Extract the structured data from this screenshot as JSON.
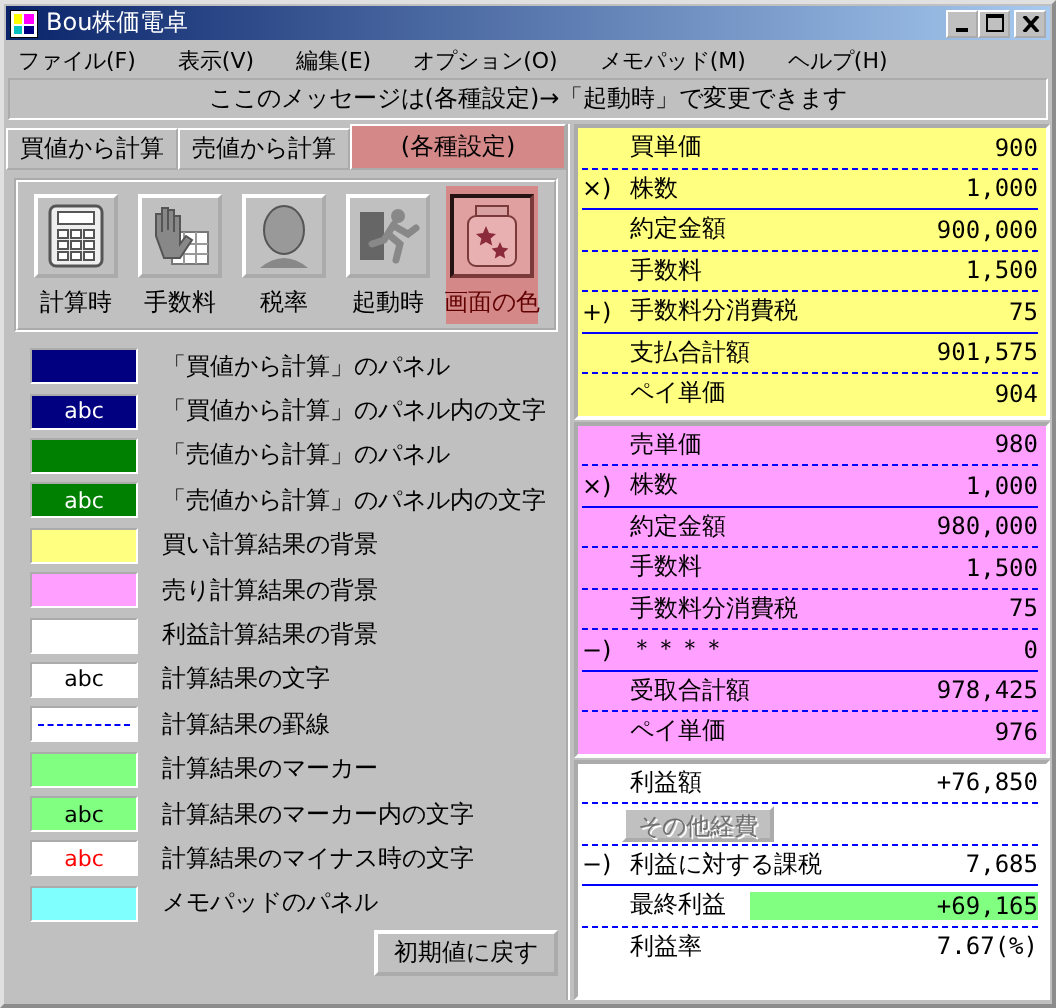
{
  "window": {
    "title": "Bou株価電卓"
  },
  "menu": [
    "ファイル(F)",
    "表示(V)",
    "編集(E)",
    "オプション(O)",
    "メモパッド(M)",
    "ヘルプ(H)"
  ],
  "message": "ここのメッセージは(各種設定)→「起動時」で変更できます",
  "tabs": [
    {
      "label": "買値から計算",
      "selected": false
    },
    {
      "label": "売値から計算",
      "selected": false
    },
    {
      "label": "(各種設定)",
      "selected": true
    }
  ],
  "settings_tools": [
    {
      "label": "計算時",
      "selected": false
    },
    {
      "label": "手数料",
      "selected": false
    },
    {
      "label": "税率",
      "selected": false
    },
    {
      "label": "起動時",
      "selected": false
    },
    {
      "label": "画面の色",
      "selected": true
    }
  ],
  "color_settings": [
    {
      "kind": "fill",
      "color": "#000080",
      "label": "「買値から計算」のパネル"
    },
    {
      "kind": "text",
      "color": "#000080",
      "sample": {
        "text": "abc",
        "color": "#ffffff"
      },
      "label": "「買値から計算」のパネル内の文字"
    },
    {
      "kind": "fill",
      "color": "#008000",
      "label": "「売値から計算」のパネル"
    },
    {
      "kind": "text",
      "color": "#008000",
      "sample": {
        "text": "abc",
        "color": "#ffffff"
      },
      "label": "「売値から計算」のパネル内の文字"
    },
    {
      "kind": "fill",
      "color": "#ffff80",
      "label": "買い計算結果の背景"
    },
    {
      "kind": "fill",
      "color": "#ff9fff",
      "label": "売り計算結果の背景"
    },
    {
      "kind": "fill",
      "color": "#ffffff",
      "label": "利益計算結果の背景"
    },
    {
      "kind": "text",
      "color": "#ffffff",
      "sample": {
        "text": "abc",
        "color": "#000000"
      },
      "label": "計算結果の文字"
    },
    {
      "kind": "line",
      "color": "#0000ff",
      "label": "計算結果の罫線"
    },
    {
      "kind": "fill",
      "color": "#80ff80",
      "label": "計算結果のマーカー"
    },
    {
      "kind": "text",
      "color": "#80ff80",
      "sample": {
        "text": "abc",
        "color": "#000000"
      },
      "label": "計算結果のマーカー内の文字"
    },
    {
      "kind": "text",
      "color": "#ffffff",
      "sample": {
        "text": "abc",
        "color": "#ff0000"
      },
      "label": "計算結果のマイナス時の文字"
    },
    {
      "kind": "fill",
      "color": "#80ffff",
      "label": "メモパッドのパネル"
    }
  ],
  "reset_button": "初期値に戻す",
  "buy_result": [
    {
      "label": "買単価",
      "value": "900",
      "rule": {
        "kind": "dashed"
      }
    },
    {
      "prefix": "×)",
      "label": "株数",
      "value": "1,000",
      "rule": {
        "kind": "solid"
      }
    },
    {
      "label": "約定金額",
      "value": "900,000",
      "rule": {
        "kind": "dashed"
      }
    },
    {
      "label": "手数料",
      "value": "1,500",
      "rule": {
        "kind": "dashed"
      }
    },
    {
      "prefix": "+)",
      "label": "手数料分消費税",
      "value": "75",
      "rule": {
        "kind": "solid"
      }
    },
    {
      "label": "支払合計額",
      "value": "901,575",
      "rule": {
        "kind": "dashed"
      }
    },
    {
      "label": "ペイ単価",
      "value": "904"
    }
  ],
  "sell_result": [
    {
      "label": "売単価",
      "value": "980",
      "rule": {
        "kind": "dashed"
      }
    },
    {
      "prefix": "×)",
      "label": "株数",
      "value": "1,000",
      "rule": {
        "kind": "solid"
      }
    },
    {
      "label": "約定金額",
      "value": "980,000",
      "rule": {
        "kind": "dashed"
      }
    },
    {
      "label": "手数料",
      "value": "1,500",
      "rule": {
        "kind": "dashed"
      }
    },
    {
      "label": "手数料分消費税",
      "value": "75",
      "rule": {
        "kind": "dashed"
      }
    },
    {
      "prefix": "−)",
      "label": "＊＊＊＊",
      "value": "0",
      "rule": {
        "kind": "solid"
      }
    },
    {
      "label": "受取合計額",
      "value": "978,425",
      "rule": {
        "kind": "dashed"
      }
    },
    {
      "label": "ペイ単価",
      "value": "976"
    }
  ],
  "profit_result": [
    {
      "kind": "row",
      "label": "利益額",
      "value": "+76,850",
      "marked": false,
      "rule": {
        "kind": "dashed"
      }
    },
    {
      "kind": "button",
      "label": "その他経費",
      "disabled": true,
      "rule": {
        "kind": "dashed"
      }
    },
    {
      "kind": "row",
      "prefix": "−)",
      "label": "利益に対する課税",
      "value": "7,685",
      "marked": false,
      "rule": {
        "kind": "solid"
      }
    },
    {
      "kind": "row",
      "label": "最終利益",
      "value": "+69,165",
      "marked": true,
      "rule": {
        "kind": "dashed"
      }
    },
    {
      "kind": "row",
      "label": "利益率",
      "value": "7.67(%)",
      "marked": false
    }
  ]
}
